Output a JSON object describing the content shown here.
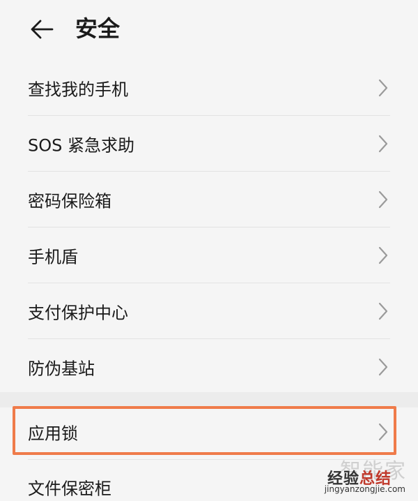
{
  "header": {
    "title": "安全"
  },
  "group1": [
    {
      "label": "查找我的手机"
    },
    {
      "label": "SOS 紧急求助"
    },
    {
      "label": "密码保险箱"
    },
    {
      "label": "手机盾"
    },
    {
      "label": "支付保护中心"
    },
    {
      "label": "防伪基站"
    }
  ],
  "group2": [
    {
      "label": "应用锁",
      "highlighted": true
    },
    {
      "label": "文件保密柜"
    }
  ],
  "watermark": {
    "line1": "智能家",
    "line2_a": "经验",
    "line2_b": "总结",
    "url": "jingyanzongjie.com"
  },
  "colors": {
    "highlight": "#ef7b4a",
    "background": "#f5f5f5",
    "chevron": "#9a9a9a"
  }
}
